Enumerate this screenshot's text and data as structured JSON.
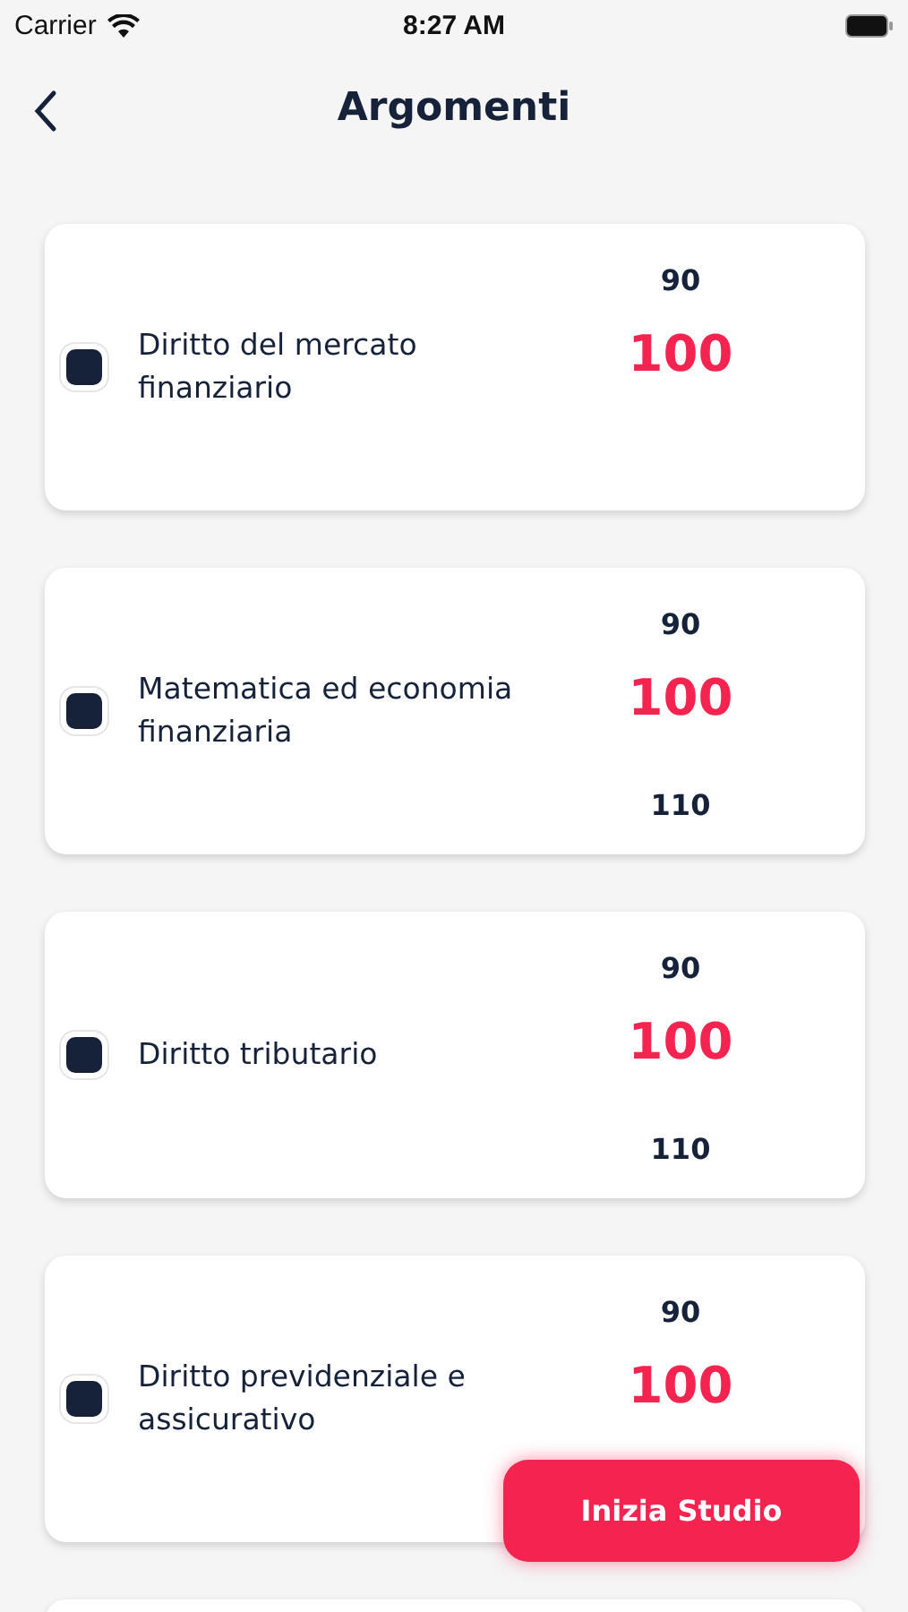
{
  "status_bar": {
    "carrier": "Carrier",
    "time": "8:27 AM"
  },
  "header": {
    "title": "Argomenti"
  },
  "topics": [
    {
      "label": "Diritto del mercato finanziario",
      "checked": false,
      "picker": [
        {
          "value": "90",
          "selected": false
        },
        {
          "value": "100",
          "selected": true
        }
      ]
    },
    {
      "label": "Matematica ed economia finanziaria",
      "checked": false,
      "picker": [
        {
          "value": "90",
          "selected": false
        },
        {
          "value": "100",
          "selected": true
        },
        {
          "value": "110",
          "selected": false
        }
      ]
    },
    {
      "label": "Diritto tributario",
      "checked": false,
      "picker": [
        {
          "value": "90",
          "selected": false
        },
        {
          "value": "100",
          "selected": true
        },
        {
          "value": "110",
          "selected": false
        }
      ]
    },
    {
      "label": "Diritto previdenziale e assicurativo",
      "checked": false,
      "picker": [
        {
          "value": "90",
          "selected": false
        },
        {
          "value": "100",
          "selected": true
        }
      ]
    }
  ],
  "start_button": "Inizia Studio"
}
